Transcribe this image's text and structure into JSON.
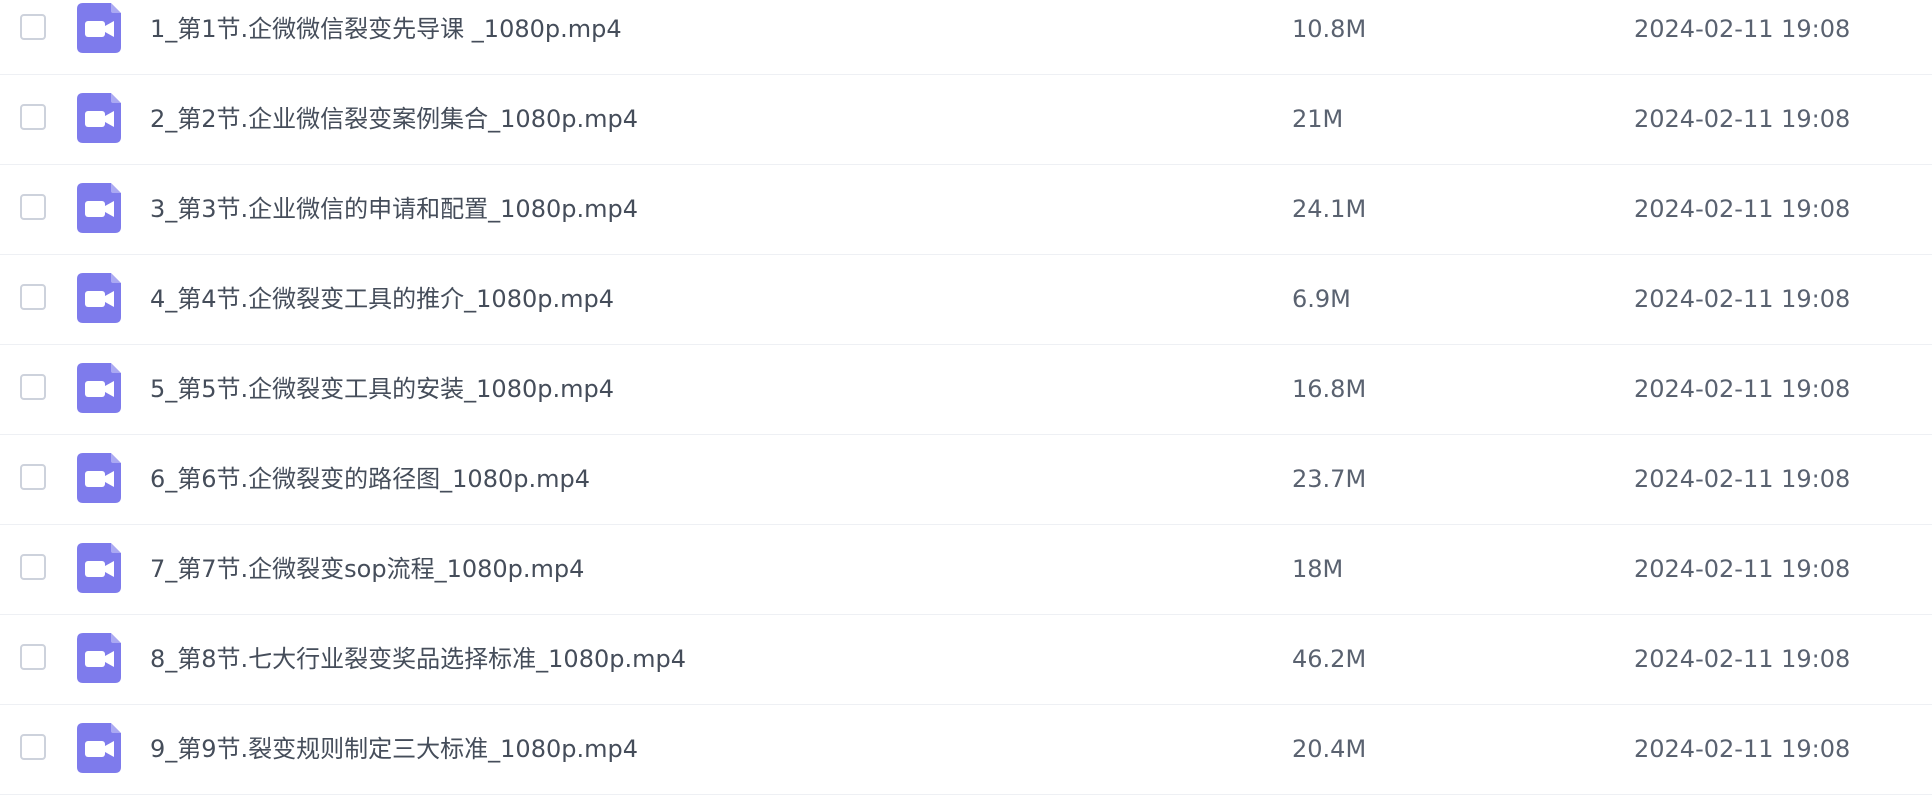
{
  "files": [
    {
      "name": "1_第1节.企微微信裂变先导课 _1080p.mp4",
      "size": "10.8M",
      "modified": "2024-02-11 19:08",
      "icon": "video-file-icon"
    },
    {
      "name": "2_第2节.企业微信裂变案例集合_1080p.mp4",
      "size": "21M",
      "modified": "2024-02-11 19:08",
      "icon": "video-file-icon"
    },
    {
      "name": "3_第3节.企业微信的申请和配置_1080p.mp4",
      "size": "24.1M",
      "modified": "2024-02-11 19:08",
      "icon": "video-file-icon"
    },
    {
      "name": "4_第4节.企微裂变工具的推介_1080p.mp4",
      "size": "6.9M",
      "modified": "2024-02-11 19:08",
      "icon": "video-file-icon"
    },
    {
      "name": "5_第5节.企微裂变工具的安装_1080p.mp4",
      "size": "16.8M",
      "modified": "2024-02-11 19:08",
      "icon": "video-file-icon"
    },
    {
      "name": "6_第6节.企微裂变的路径图_1080p.mp4",
      "size": "23.7M",
      "modified": "2024-02-11 19:08",
      "icon": "video-file-icon"
    },
    {
      "name": "7_第7节.企微裂变sop流程_1080p.mp4",
      "size": "18M",
      "modified": "2024-02-11 19:08",
      "icon": "video-file-icon"
    },
    {
      "name": "8_第8节.七大行业裂变奖品选择标准_1080p.mp4",
      "size": "46.2M",
      "modified": "2024-02-11 19:08",
      "icon": "video-file-icon"
    },
    {
      "name": "9_第9节.裂变规则制定三大标准_1080p.mp4",
      "size": "20.4M",
      "modified": "2024-02-11 19:08",
      "icon": "video-file-icon"
    }
  ],
  "colors": {
    "icon": "#7e7bec",
    "icon_glyph": "#ffffff",
    "text": "#454d5a",
    "divider": "#eef0f4",
    "checkbox_border": "#cdd2dc"
  }
}
